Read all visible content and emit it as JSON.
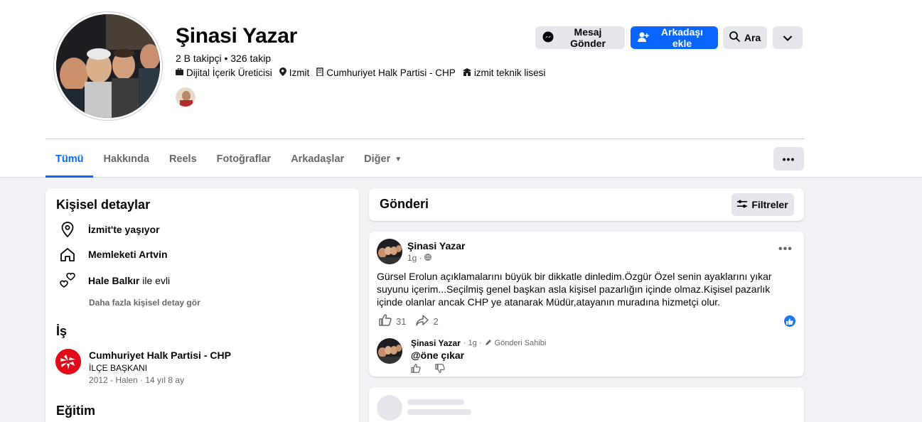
{
  "profile": {
    "name": "Şinasi Yazar",
    "follow_text": "2 B takipçi • 326 takip",
    "info": [
      {
        "icon": "briefcase-icon",
        "label": "Dijital İçerik Üreticisi"
      },
      {
        "icon": "location-icon",
        "label": "Izmit"
      },
      {
        "icon": "work-icon",
        "label": "Cumhuriyet Halk Partisi - CHP"
      },
      {
        "icon": "school-icon",
        "label": "izmit teknik lisesi"
      }
    ]
  },
  "actions": {
    "message": "Mesaj Gönder",
    "add_friend": "Arkadaşı ekle",
    "search": "Ara"
  },
  "tabs": [
    {
      "label": "Tümü",
      "active": true
    },
    {
      "label": "Hakkında"
    },
    {
      "label": "Reels"
    },
    {
      "label": "Fotoğraflar"
    },
    {
      "label": "Arkadaşlar"
    },
    {
      "label": "Diğer"
    }
  ],
  "details": {
    "title": "Kişisel detaylar",
    "lives": "İzmit'te yaşıyor",
    "hometown": "Memleketi Artvin",
    "relationship_name": "Hale Balkır",
    "relationship_suffix": "ile evli",
    "more": "Daha fazla kişisel detay gör",
    "work_title": "İş",
    "job_name": "Cumhuriyet Halk Partisi - CHP",
    "job_position": "İLÇE BAŞKANI",
    "job_time": "2012 - Halen · 14 yıl 8 ay",
    "education_title": "Eğitim"
  },
  "posts_header": {
    "title": "Gönderi",
    "filter": "Filtreler"
  },
  "post": {
    "author": "Şinasi Yazar",
    "time": "1g ·",
    "text": "Gürsel Erolun açıklamalarını büyük bir dikkatle  dinledim.Özgür Özel senin ayaklarını yıkar suyunu içerim...Seçilmiş genel başkan asla kişisel pazarlığın içinde olmaz.Kişisel pazarlık içinde olanlar ancak CHP ye atanarak Müdür,atayanın muradına hizmetçi olur.",
    "likes": "31",
    "shares": "2",
    "comment_author": "Şinasi Yazar",
    "comment_meta": "· 1g ·",
    "comment_badge": "Gönderi Sahibi",
    "comment_text": "@öne çıkar"
  },
  "colors": {
    "accent": "#0866ff",
    "chp_red": "#e30a17"
  }
}
